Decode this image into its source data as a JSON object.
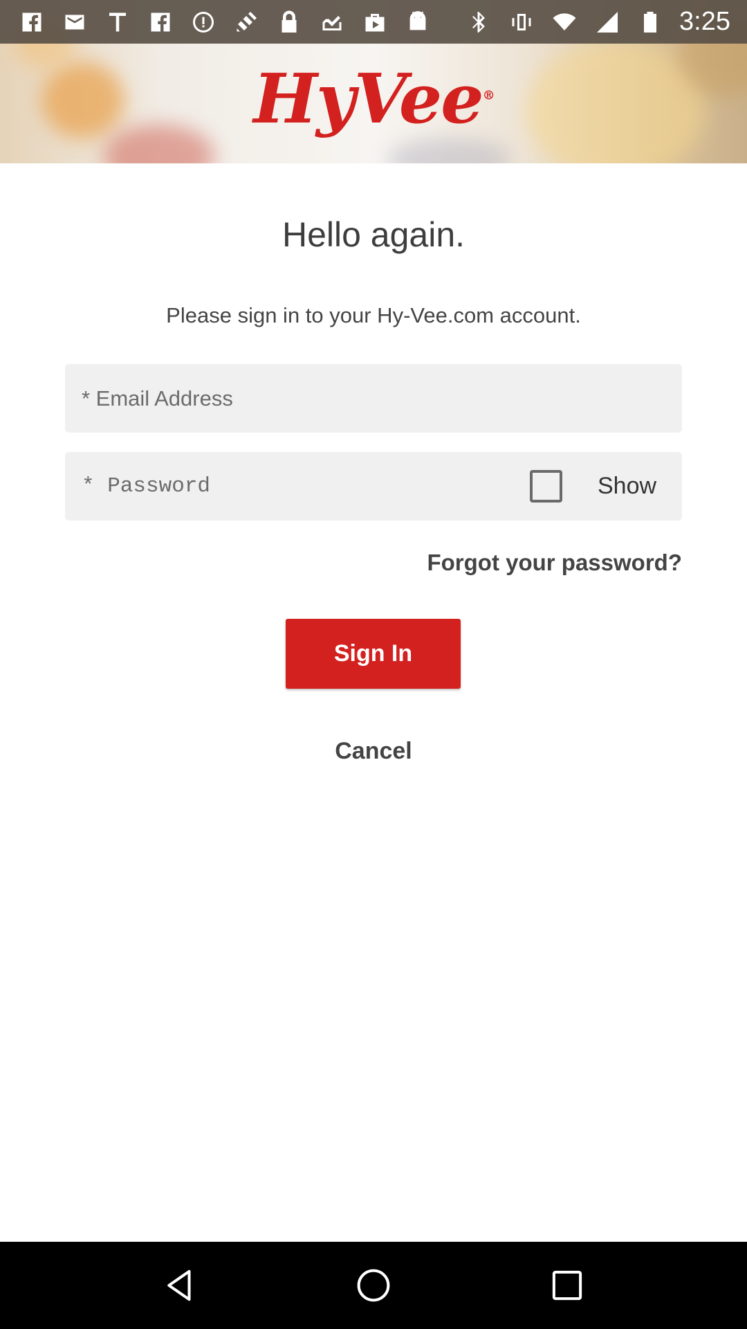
{
  "status_bar": {
    "time": "3:25",
    "left_icons": [
      "facebook-icon",
      "mail-icon",
      "text-t-icon",
      "facebook-icon",
      "alert-icon",
      "satellite-icon",
      "lock-icon",
      "inbox-check-icon",
      "play-store-icon",
      "android-icon"
    ],
    "right_icons": [
      "bluetooth-icon",
      "vibrate-icon",
      "wifi-icon",
      "signal-icon",
      "battery-icon"
    ]
  },
  "banner": {
    "logo_text": "HyVee",
    "logo_mark": "®",
    "brand_color": "#d3211f"
  },
  "login": {
    "title": "Hello again.",
    "subtitle": "Please sign in to your Hy-Vee.com account.",
    "email_placeholder": "* Email Address",
    "password_placeholder": "* Password",
    "show_label": "Show",
    "show_checked": false,
    "forgot_label": "Forgot your password?",
    "signin_label": "Sign In",
    "cancel_label": "Cancel"
  },
  "nav_bar": {
    "buttons": [
      "back-icon",
      "home-icon",
      "recents-icon"
    ]
  }
}
